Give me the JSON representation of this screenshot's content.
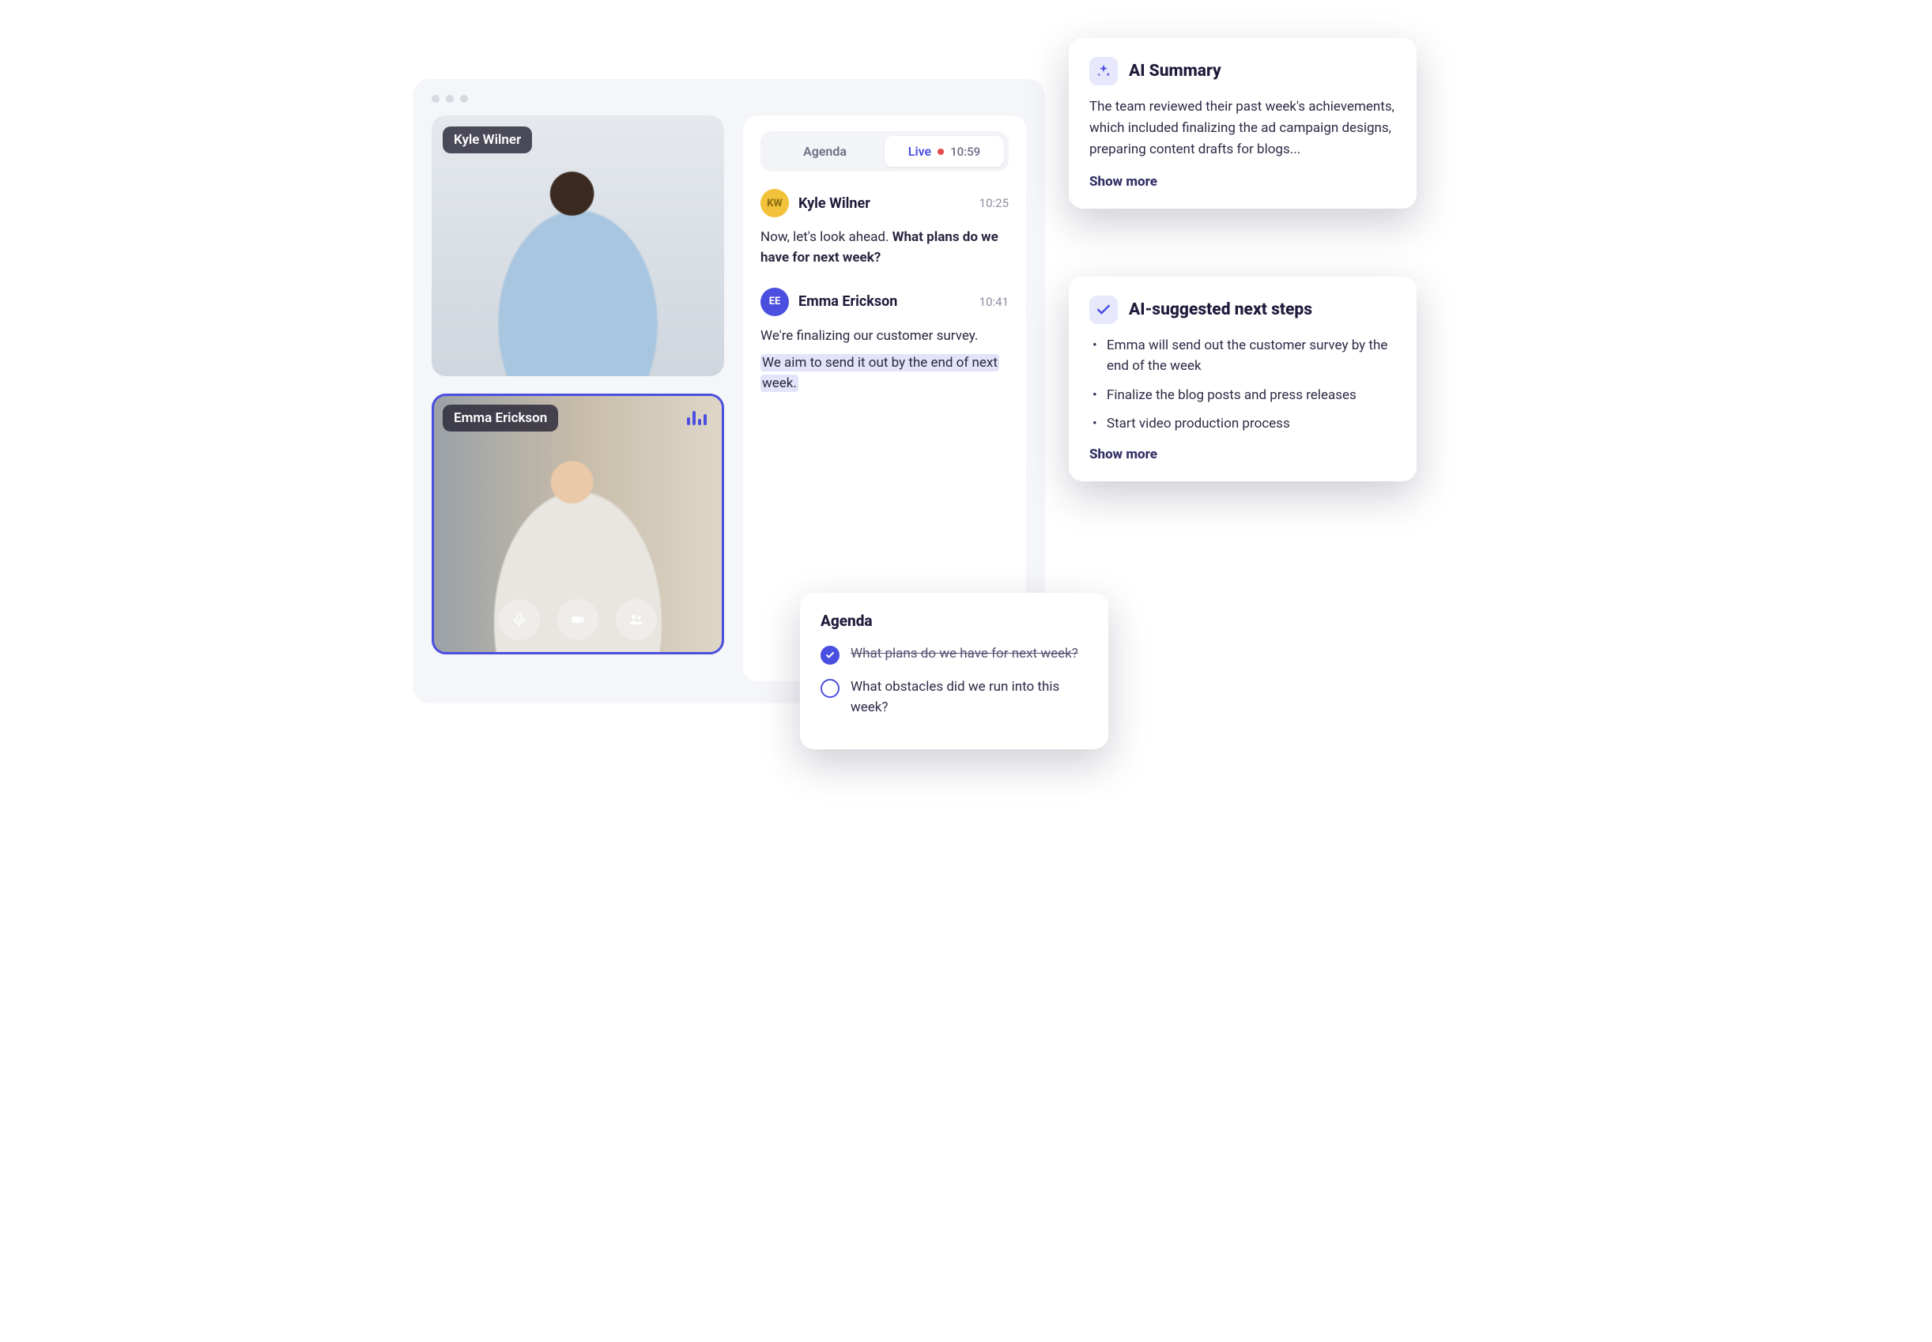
{
  "video": {
    "tile1": {
      "name": "Kyle Wilner"
    },
    "tile2": {
      "name": "Emma Erickson"
    }
  },
  "tabs": {
    "agenda": "Agenda",
    "live": "Live",
    "time": "10:59"
  },
  "transcript": [
    {
      "initials": "KW",
      "name": "Kyle Wilner",
      "time": "10:25",
      "text_plain": "Now, let's look ahead. ",
      "text_bold": "What plans do we have for next week?"
    },
    {
      "initials": "EE",
      "name": "Emma Erickson",
      "time": "10:41",
      "line1": "We're finalizing our customer survey.",
      "line2": "We aim to send it out by the end of next week."
    }
  ],
  "ai_summary": {
    "title": "AI Summary",
    "body": "The team reviewed their past week's achievements, which included finalizing the ad campaign designs, preparing content drafts for blogs...",
    "more": "Show more"
  },
  "ai_steps": {
    "title": "AI-suggested next steps",
    "items": [
      "Emma will send out the customer survey by the end of the week",
      "Finalize the blog posts and press releases",
      "Start video production process"
    ],
    "more": "Show more"
  },
  "agenda": {
    "title": "Agenda",
    "items": [
      {
        "text": "What plans do we have for next week?",
        "done": true
      },
      {
        "text": "What obstacles did we run into this week?",
        "done": false
      }
    ]
  }
}
